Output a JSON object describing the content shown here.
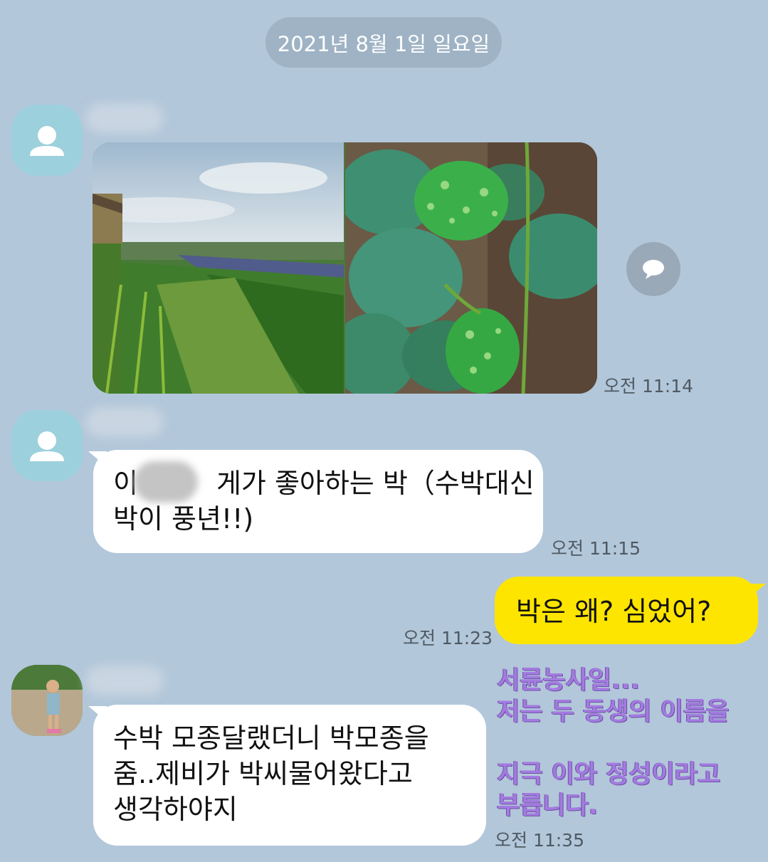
{
  "date_divider": "2021년 8월 1일 일요일",
  "colors": {
    "background": "#b2c7da",
    "incoming_bubble": "#ffffff",
    "outgoing_bubble": "#fee500",
    "overlay_text": "#a37be0"
  },
  "messages": [
    {
      "sender": "incoming",
      "avatar_icon": "default-person-icon",
      "type": "photos",
      "photos": [
        "farm-field-photo",
        "gourds-on-vine-photo"
      ],
      "time": "오전 11:14"
    },
    {
      "sender": "incoming",
      "avatar_icon": "default-person-icon",
      "type": "text",
      "lines": [
        "이",
        "게가 좋아하는 박（수박대신",
        "박이 풍년!!)"
      ],
      "time": "오전 11:15"
    },
    {
      "sender": "me",
      "type": "text",
      "text": "박은 왜? 심었어?",
      "time": "오전 11:23"
    },
    {
      "sender": "incoming",
      "avatar_icon": "child-photo-avatar",
      "type": "text",
      "lines": [
        "수박 모종달랬더니 박모종을",
        "줌..제비가 박씨물어왔다고",
        "생각하야지"
      ],
      "time": "오전 11:35"
    }
  ],
  "overlay_caption": [
    "서륜농사일...",
    "저는 두 동생의 이름을",
    "",
    "지극 이와 정성이라고",
    "부릅니다."
  ]
}
